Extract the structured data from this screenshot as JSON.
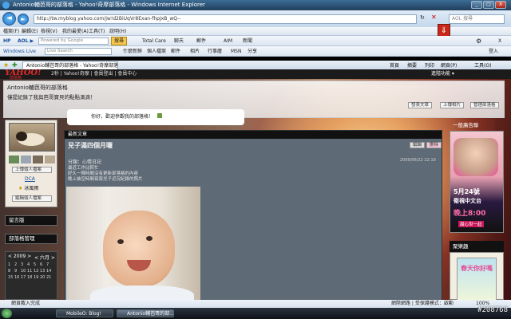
{
  "window": {
    "title": "Antonio輔芭哥的部落格 - Yahoo!奇摩部落格 - Windows Internet Explorer",
    "min": "_",
    "max": "□",
    "close": "X"
  },
  "address": {
    "url": "http://tw.myblog.yahoo.com/jw!d2BiUqVr8Exan-fhpJxB_wQ--",
    "search_placeholder": "AOL 搜尋"
  },
  "menu": [
    "檔案(F)",
    "編輯(E)",
    "檢視(V)",
    "我的最愛(A)",
    "工具(T)",
    "說明(H)"
  ],
  "toolbar1": {
    "aol_label": "AOL ▶",
    "search_placeholder": "Powered by Google",
    "search_btn": "搜尋",
    "items": [
      "Total Care",
      "聊天",
      "郵件",
      "AIM",
      "新聞"
    ],
    "gear": "⚙",
    "close": "X"
  },
  "toolbar2": {
    "wl_label": "Windows Live",
    "search_placeholder": "Live Search",
    "items": [
      "什麼新鮮",
      "個人檔案",
      "郵件",
      "相片",
      "行事曆",
      "MSN",
      "分享"
    ],
    "login": "登入"
  },
  "tabsrow": {
    "tab_label": "Antonio輔芭哥的部落格 - Yahoo!奇摩部落格",
    "cmds": [
      "首頁",
      "摘要",
      "列印",
      "網頁(P)",
      "工具(O)"
    ]
  },
  "blog": {
    "ybar_logo": "YAHOO!",
    "ybar_sub": "部落格",
    "ybar_text": "2秒 | Yahoo!奇摩 | 會員登出 | 會員中心",
    "ybar_right": "進階功能 ▾",
    "title": "Antonio輔芭哥的部落格",
    "subtitle": "僅提紀錄了我與芭哥寶貝的點點滴滴！",
    "actions": [
      "發表文章",
      "上傳相片",
      "管理部落格"
    ],
    "bubble_text": "你好，歡迎參觀我的部落格！"
  },
  "left": {
    "upload_btn": "上傳個人檔案",
    "name": "DCA",
    "tag": "冰風雨",
    "edit_btn": "編輯個人檔案",
    "guestbook": "留言版",
    "mgmt": "部落格管理",
    "calendar_year": "< 2009 >",
    "calendar_month": "< 六月 >",
    "calendar_days": [
      "1",
      "2",
      "3",
      "4",
      "5",
      "6",
      "7",
      "8",
      "9",
      "10",
      "11",
      "12",
      "13",
      "14",
      "15",
      "16",
      "17",
      "18",
      "19",
      "20",
      "21"
    ]
  },
  "article": {
    "header": "最新文章",
    "title": "兒子滿四個月囉",
    "btn_edit": "編輯",
    "btn_delete": "刪除",
    "category": "分類：心情日記",
    "date": "2009/06/22 22:19",
    "body": [
      "最近工作比較忙",
      "好久一陣時間沒有更新部落格的內容",
      "晚上抽空時間寫寫兒子近況紀錄的照片"
    ]
  },
  "right": {
    "ad_header": "一般廣告聯",
    "ad_line1": "5月24號",
    "ad_line2": "衛視中文台",
    "ad_line3": "晚上8:00",
    "ad_line4": "甜心世一起",
    "ad2_header": "聚樂趣",
    "ad2_text": "春天你好嗎"
  },
  "statusbar": {
    "left": "網頁載入完成",
    "right": "網際網路 | 受保護模式：啟動",
    "zoom": "100%"
  },
  "taskbar": {
    "items": [
      "MobileO: Blog!",
      "Antonio輔芭哥的部..."
    ],
    "watermark": "#208768"
  }
}
